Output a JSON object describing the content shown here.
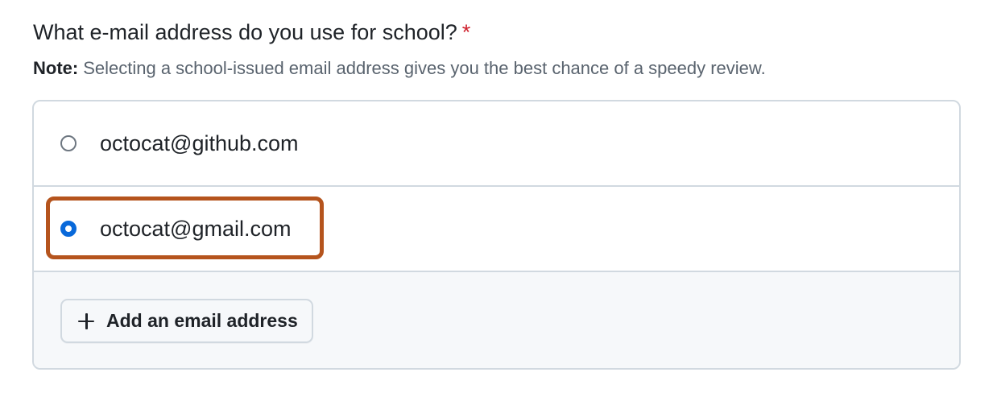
{
  "question": {
    "text": "What e-mail address do you use for school?",
    "required_marker": "*"
  },
  "note": {
    "label": "Note:",
    "text": "Selecting a school-issued email address gives you the best chance of a speedy review."
  },
  "email_options": [
    {
      "label": "octocat@github.com",
      "selected": false
    },
    {
      "label": "octocat@gmail.com",
      "selected": true
    }
  ],
  "add_email_button": {
    "label": "Add an email address",
    "icon": "plus-icon"
  },
  "colors": {
    "required": "#cf222e",
    "radio_selected": "#0969da",
    "highlight_border": "#b5541d",
    "border": "#d1d9e0",
    "footer_background": "#f6f8fa"
  }
}
